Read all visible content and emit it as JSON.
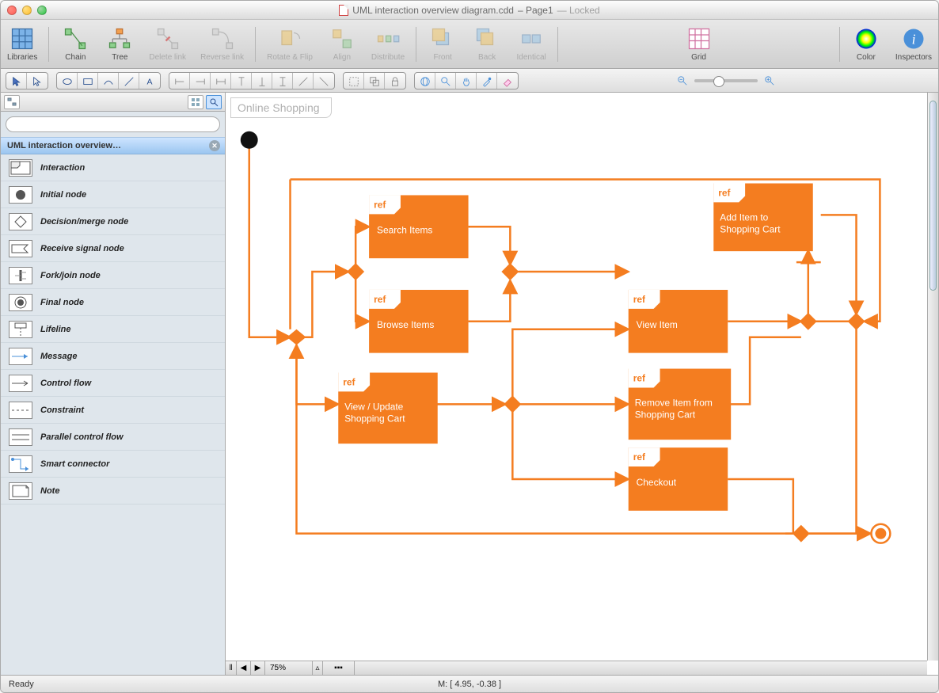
{
  "window": {
    "title_main": "UML interaction overview diagram.cdd",
    "title_sub": "Page1",
    "title_locked": "Locked"
  },
  "toolbar": {
    "libraries": "Libraries",
    "chain": "Chain",
    "tree": "Tree",
    "delete_link": "Delete link",
    "reverse_link": "Reverse link",
    "rotate_flip": "Rotate & Flip",
    "align": "Align",
    "distribute": "Distribute",
    "front": "Front",
    "back": "Back",
    "identical": "Identical",
    "grid": "Grid",
    "color": "Color",
    "inspectors": "Inspectors"
  },
  "sidebar": {
    "header": "UML interaction overview…",
    "search_placeholder": "",
    "items": [
      {
        "label": "Interaction"
      },
      {
        "label": "Initial node"
      },
      {
        "label": "Decision/merge node"
      },
      {
        "label": "Receive signal node"
      },
      {
        "label": "Fork/join node"
      },
      {
        "label": "Final node"
      },
      {
        "label": "Lifeline"
      },
      {
        "label": "Message"
      },
      {
        "label": "Control flow"
      },
      {
        "label": "Constraint"
      },
      {
        "label": "Parallel control flow"
      },
      {
        "label": "Smart connector"
      },
      {
        "label": "Note"
      }
    ]
  },
  "diagram": {
    "title": "Online Shopping",
    "ref_label": "ref",
    "nodes": {
      "search_items": "Search Items",
      "browse_items": "Browse Items",
      "view_update_cart": "View / Update Shopping Cart",
      "view_item": "View Item",
      "add_item": "Add Item to Shopping Cart",
      "remove_item": "Remove Item from Shopping Cart",
      "checkout": "Checkout"
    }
  },
  "footer": {
    "zoom": "75%",
    "status": "Ready",
    "mouse": "M: [ 4.95, -0.38 ]"
  }
}
